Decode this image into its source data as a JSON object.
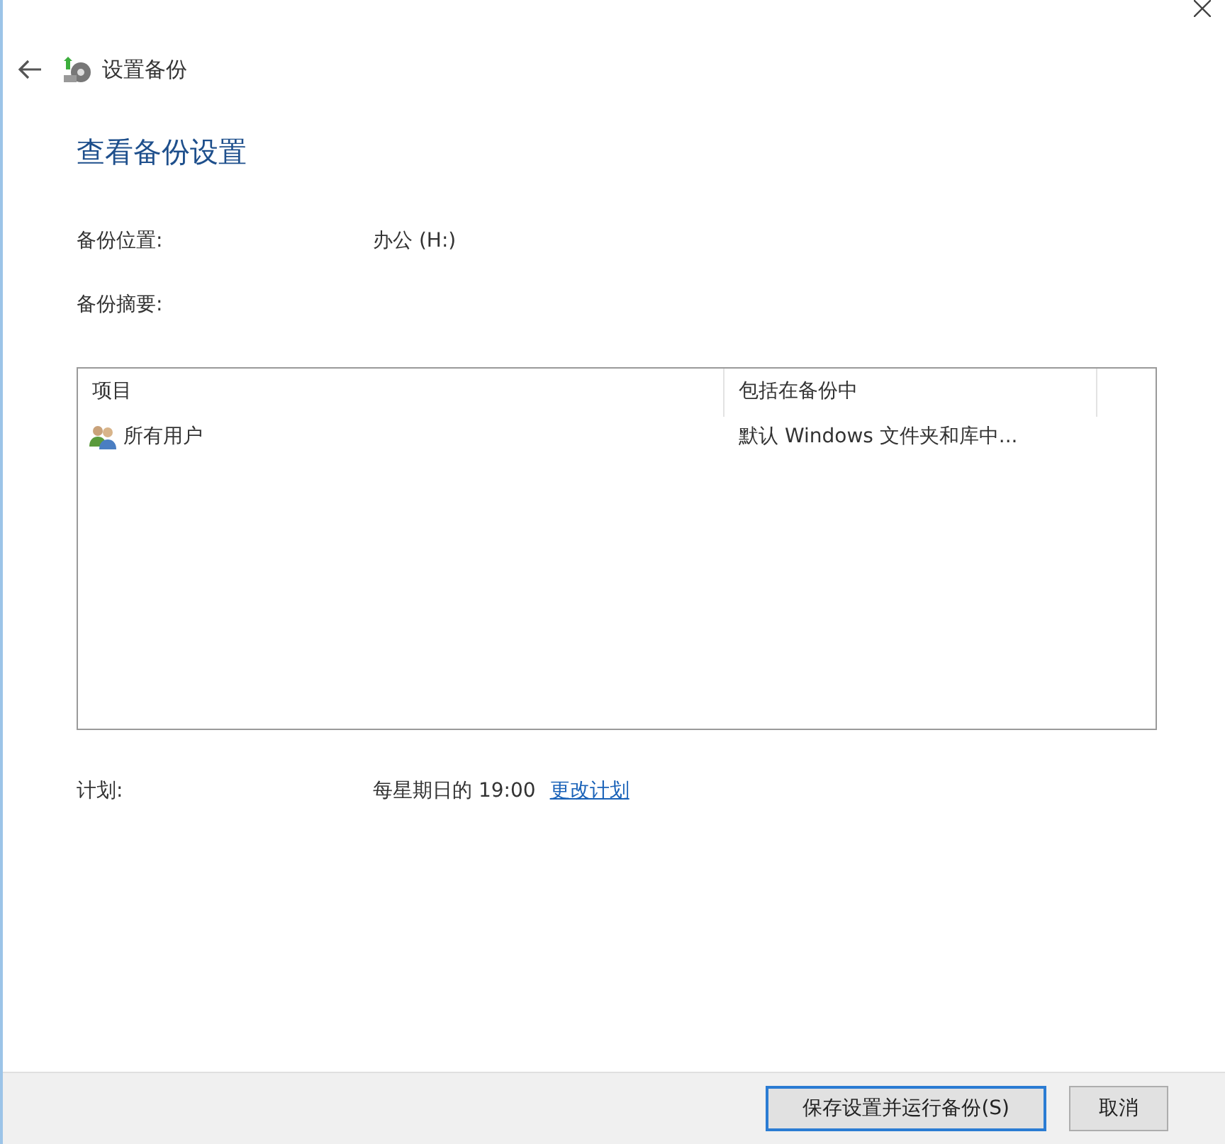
{
  "window": {
    "title": "设置备份"
  },
  "heading": "查看备份设置",
  "fields": [
    {
      "label": "备份位置:",
      "value": "办公 (H:)"
    },
    {
      "label": "备份摘要:"
    }
  ],
  "table": {
    "columns": [
      "项目",
      "包括在备份中"
    ],
    "rows": [
      {
        "item": "所有用户",
        "included": "默认 Windows 文件夹和库中..."
      }
    ]
  },
  "schedule": {
    "label": "计划:",
    "value": "每星期日的 19:00",
    "link": "更改计划"
  },
  "buttons": [
    {
      "label": "保存设置并运行备份(S)",
      "kind": "primary"
    },
    {
      "label": "取消",
      "kind": "secondary"
    }
  ]
}
